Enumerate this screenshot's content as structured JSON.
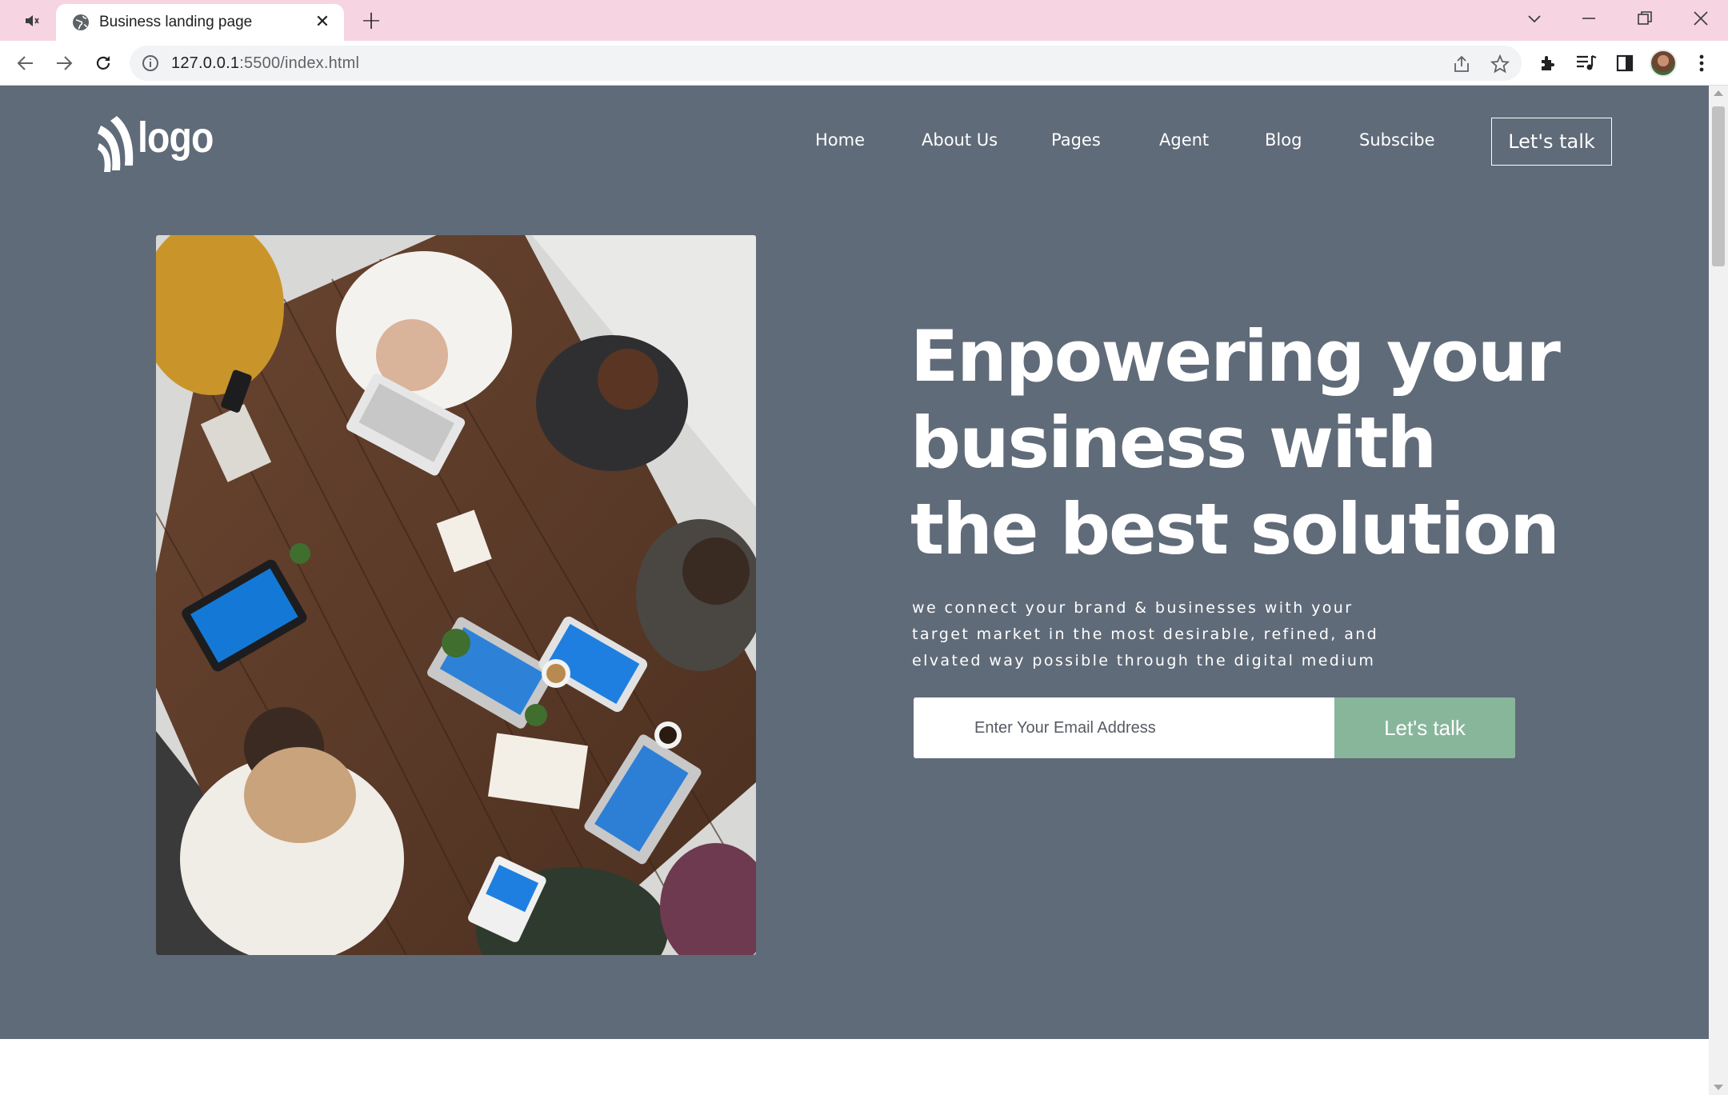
{
  "browser": {
    "tab": {
      "title": "Business landing page"
    },
    "address": {
      "host": "127.0.0.1",
      "path": ":5500/index.html"
    }
  },
  "site": {
    "logo_text": "logo",
    "nav": [
      "Home",
      "About Us",
      "Pages",
      "Agent",
      "Blog",
      "Subscibe"
    ],
    "nav_cta": "Let's talk"
  },
  "hero": {
    "headline": [
      "Enpowering your",
      "business with",
      "the best solution"
    ],
    "subtitle": [
      "we connect your brand & businesses with your",
      "target market in the most desirable, refined, and",
      "elvated way possible through the digital medium"
    ],
    "email_placeholder": "Enter Your Email Address",
    "button": "Let's talk"
  },
  "colors": {
    "hero_bg": "#606b79",
    "button_green": "#87b69b",
    "tabbar_pink": "#f6d4e2"
  }
}
